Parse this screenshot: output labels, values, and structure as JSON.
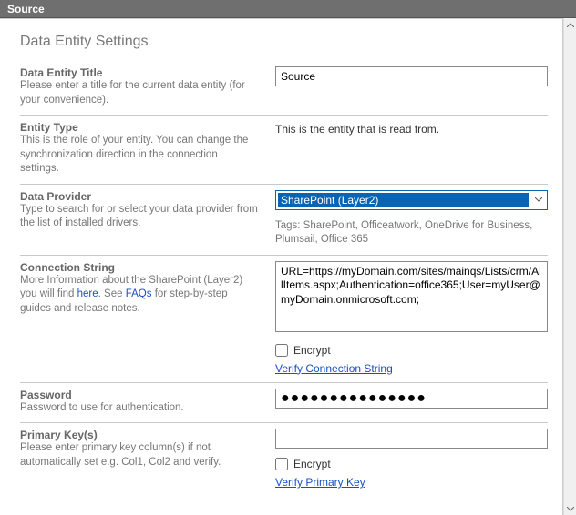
{
  "window": {
    "title": "Source"
  },
  "section": {
    "heading": "Data Entity Settings"
  },
  "entityTitle": {
    "label": "Data Entity Title",
    "desc": "Please enter a title for the current data entity (for your convenience).",
    "value": "Source"
  },
  "entityType": {
    "label": "Entity Type",
    "desc": "This is the role of your entity. You can change the synchronization direction in the connection settings.",
    "value": "This is the entity that is read from."
  },
  "dataProvider": {
    "label": "Data Provider",
    "desc": "Type to search for or select your data provider from the list of installed drivers.",
    "value": "SharePoint (Layer2)",
    "tags": "Tags: SharePoint, Officeatwork, OneDrive for Business, Plumsail, Office 365"
  },
  "connectionString": {
    "label": "Connection String",
    "descParts": {
      "pre": "More Information about the SharePoint (Layer2) you will find ",
      "hereText": "here",
      "mid": ". See ",
      "faqText": "FAQs",
      "post": " for step-by-step guides and release notes."
    },
    "value": "URL=https://myDomain.com/sites/mainqs/Lists/crm/AllItems.aspx;Authentication=office365;User=myUser@myDomain.onmicrosoft.com;",
    "encryptLabel": "Encrypt",
    "verifyLink": "Verify Connection String"
  },
  "password": {
    "label": "Password",
    "desc": "Password to use for authentication.",
    "value": "●●●●●●●●●●●●●●●"
  },
  "primaryKey": {
    "label": "Primary Key(s)",
    "desc": "Please enter primary key column(s) if not automatically set e.g. Col1, Col2 and verify.",
    "value": "",
    "encryptLabel": "Encrypt",
    "verifyLink": "Verify Primary Key"
  }
}
